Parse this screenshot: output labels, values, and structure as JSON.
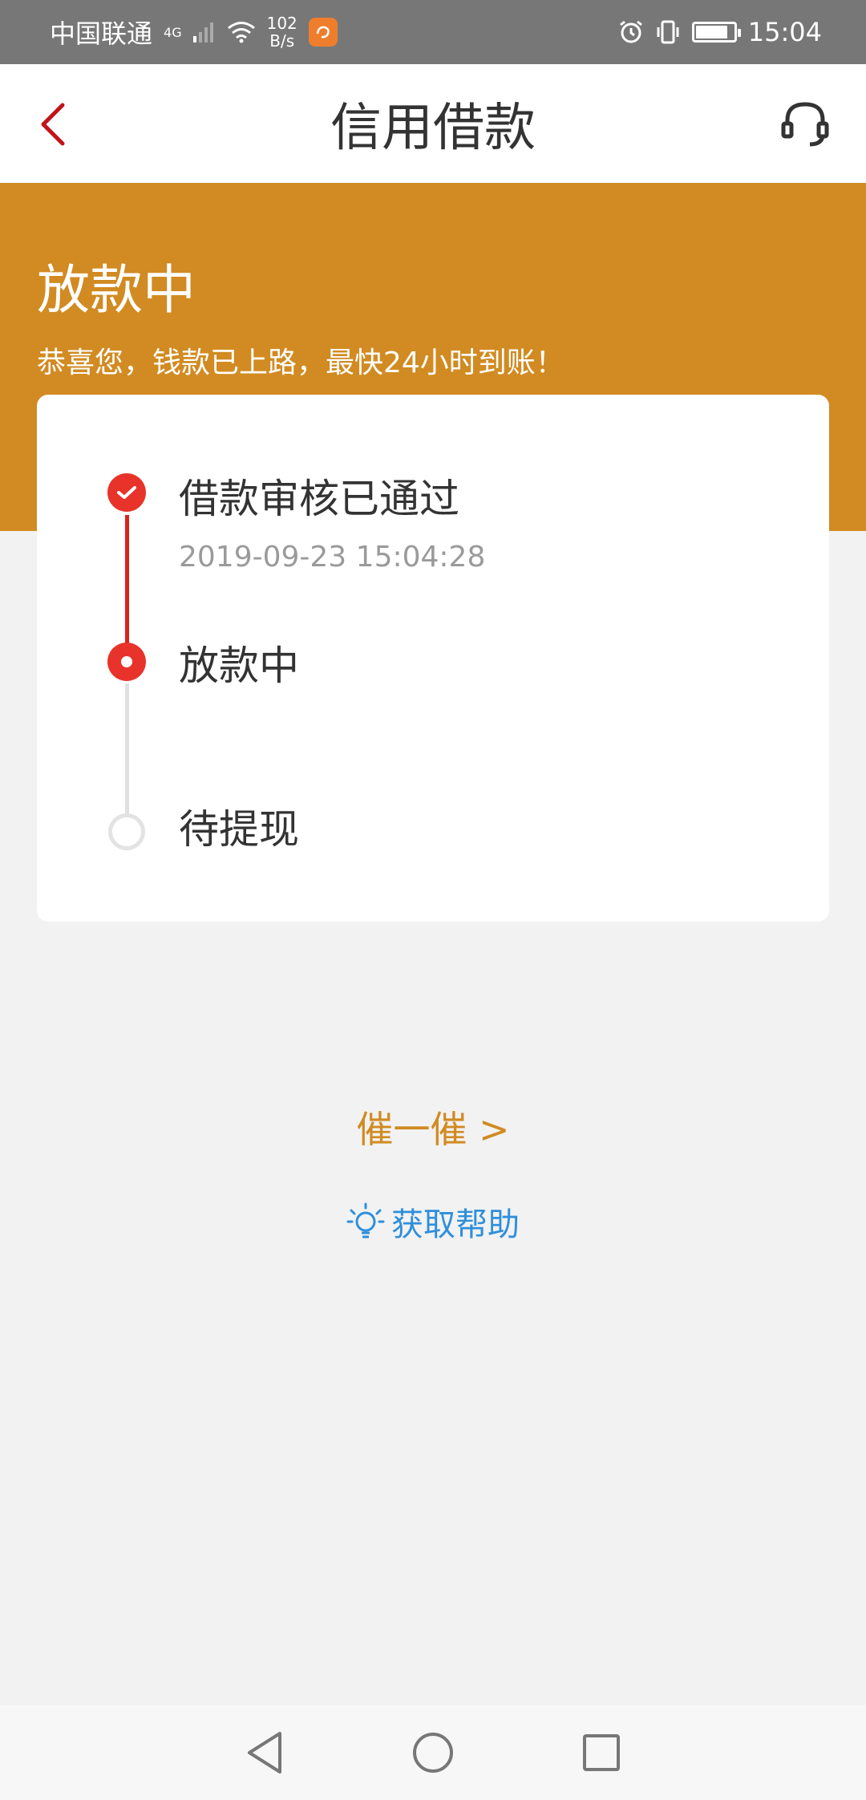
{
  "status_bar": {
    "carrier": "中国联通",
    "network": "4G",
    "speed_value": "102",
    "speed_unit": "B/s",
    "time": "15:04"
  },
  "header": {
    "title": "信用借款"
  },
  "banner": {
    "title": "放款中",
    "subtitle": "恭喜您，钱款已上路，最快24小时到账！"
  },
  "steps": [
    {
      "label": "借款审核已通过",
      "time": "2019-09-23 15:04:28",
      "state": "done"
    },
    {
      "label": "放款中",
      "state": "active"
    },
    {
      "label": "待提现",
      "state": "pending"
    }
  ],
  "actions": {
    "urge_label": "催一催 >",
    "help_label": "获取帮助"
  },
  "colors": {
    "accent_orange": "#d18b22",
    "progress_red": "#e8332b",
    "link_blue": "#2f8fdc"
  },
  "icons": {
    "back": "back-arrow-icon",
    "customer_service": "headset-icon",
    "help": "lightbulb-icon"
  }
}
